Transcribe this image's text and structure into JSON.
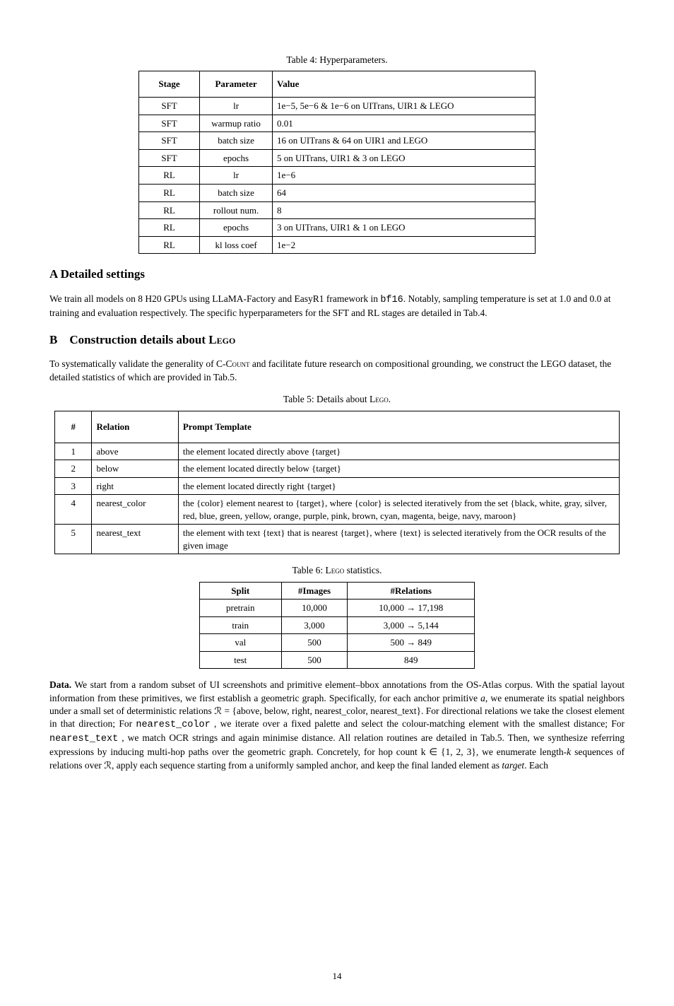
{
  "table1": {
    "caption_pre": "Table 4:",
    "caption": "Hyperparameters.",
    "headers": [
      "Stage",
      "Parameter",
      "Value"
    ],
    "rows": [
      [
        "SFT",
        "lr",
        "1e−5, 5e−6 & 1e−6 on UITrans, UIR1 & LEGO"
      ],
      [
        "SFT",
        "warmup ratio",
        "0.01"
      ],
      [
        "SFT",
        "batch size",
        "16 on UITrans & 64 on UIR1 and LEGO"
      ],
      [
        "SFT",
        "epochs",
        "5 on UITrans, UIR1 & 3 on LEGO"
      ],
      [
        "RL",
        "lr",
        "1e−6"
      ],
      [
        "RL",
        "batch size",
        "64"
      ],
      [
        "RL",
        "rollout num.",
        "8"
      ],
      [
        "RL",
        "epochs",
        "3 on UITrans, UIR1 & 1 on LEGO"
      ],
      [
        "RL",
        "kl loss coef",
        "1e−2"
      ]
    ]
  },
  "sectionA": {
    "title": "A    Detailed settings",
    "para": "We train all models on 8 H20 GPUs using LLaMA-Factory and EasyR1 framework in",
    "para_cont": ". Notably, sampling temperature is set at 1.0 and 0.0 at training and evaluation respectively. The specific hyperparameters for the SFT and RL stages are detailed in Tab.4.",
    "mode_em": "bf16"
  },
  "sectionB": {
    "num": "B",
    "title": "Construction details about L",
    "title_sc": "ego",
    "para": "To systematically validate the generality of C-C",
    "para_sc": "ount",
    "para_cont": " and facilitate future research on compositional grounding, we construct the LEGO dataset, the detailed statistics of which are provided in Tab.5."
  },
  "table2": {
    "caption_pre": "Table 5:",
    "caption": " Details about L",
    "caption_sc": "ego",
    "caption_dot": ".",
    "headers": [
      "#",
      "Relation",
      "Prompt Template"
    ],
    "rows": [
      {
        "num": "1",
        "rel": "above",
        "tmpl": "the element located directly above {target}"
      },
      {
        "num": "2",
        "rel": "below",
        "tmpl": "the element located directly below {target}"
      },
      {
        "num": "3",
        "rel": "right",
        "tmpl": "the element located directly right {target}"
      },
      {
        "num": "4",
        "rel": "nearest_color",
        "tmpl": "the {color} element nearest to {target}, where {color} is selected iteratively from the set {black, white, gray, silver, red, blue, green, yellow, orange, purple, pink, brown, cyan, magenta, beige, navy, maroon}"
      },
      {
        "num": "5",
        "rel": "nearest_text",
        "tmpl": "the element with text {text} that is nearest {target}, where {text} is selected iteratively from the OCR results of the given image"
      }
    ]
  },
  "table3": {
    "caption_pre": "Table 6:",
    "caption": " L",
    "caption_sc": "ego",
    "caption_post": " statistics.",
    "headers": [
      "Split",
      "#Images",
      "#Relations"
    ],
    "rows": [
      {
        "split": "pretrain",
        "imgs": "10,000",
        "rel": "10,000 → 17,198"
      },
      {
        "split": "train",
        "imgs": "3,000",
        "rel": "3,000 → 5,144"
      },
      {
        "split": "val",
        "imgs": "500",
        "rel": "500 → 849"
      },
      {
        "split": "test",
        "imgs": "500",
        "rel": "849"
      }
    ]
  },
  "data_para": {
    "lead_bold": "Data.",
    "text1": "We start from a random subset of UI screenshots and primitive element–bbox annotations from the OS-Atlas corpus. With the spatial layout information from these primitives, we first establish a geometric graph. Specifically, for each anchor primitive ",
    "anchor": "a",
    "text2": ", we enumerate its spatial neighbors under a small set of deterministic relations",
    "rel_var": "R",
    "rel_eq": " = ",
    "rel_set": "{above, below, right, nearest_color, nearest_text}",
    "text3": ". For directional relations we take the closest element in that direction; For ",
    "nc": "nearest_color",
    "text4": " , we iterate over a fixed palette and select the colour-matching element with the smallest distance; For ",
    "nt": "nearest_text",
    "text5": " , we match OCR strings and again minimise distance. All relation routines are detailed in Tab.5. Then, we synthesize referring expressions by inducing multi-hop paths over the geometric graph. Concretely, for hop count ",
    "hopk": "k ∈ {1, 2, 3}",
    "text6": ", we enumerate length-",
    "k": "k",
    "text7": " sequences of relations over ",
    "Rvar": "R",
    "text8": ", apply each sequence starting from a uniformly sampled anchor, and keep the final landed element as ",
    "tgt": "target",
    "text9": ". Each"
  },
  "page_number": "14"
}
